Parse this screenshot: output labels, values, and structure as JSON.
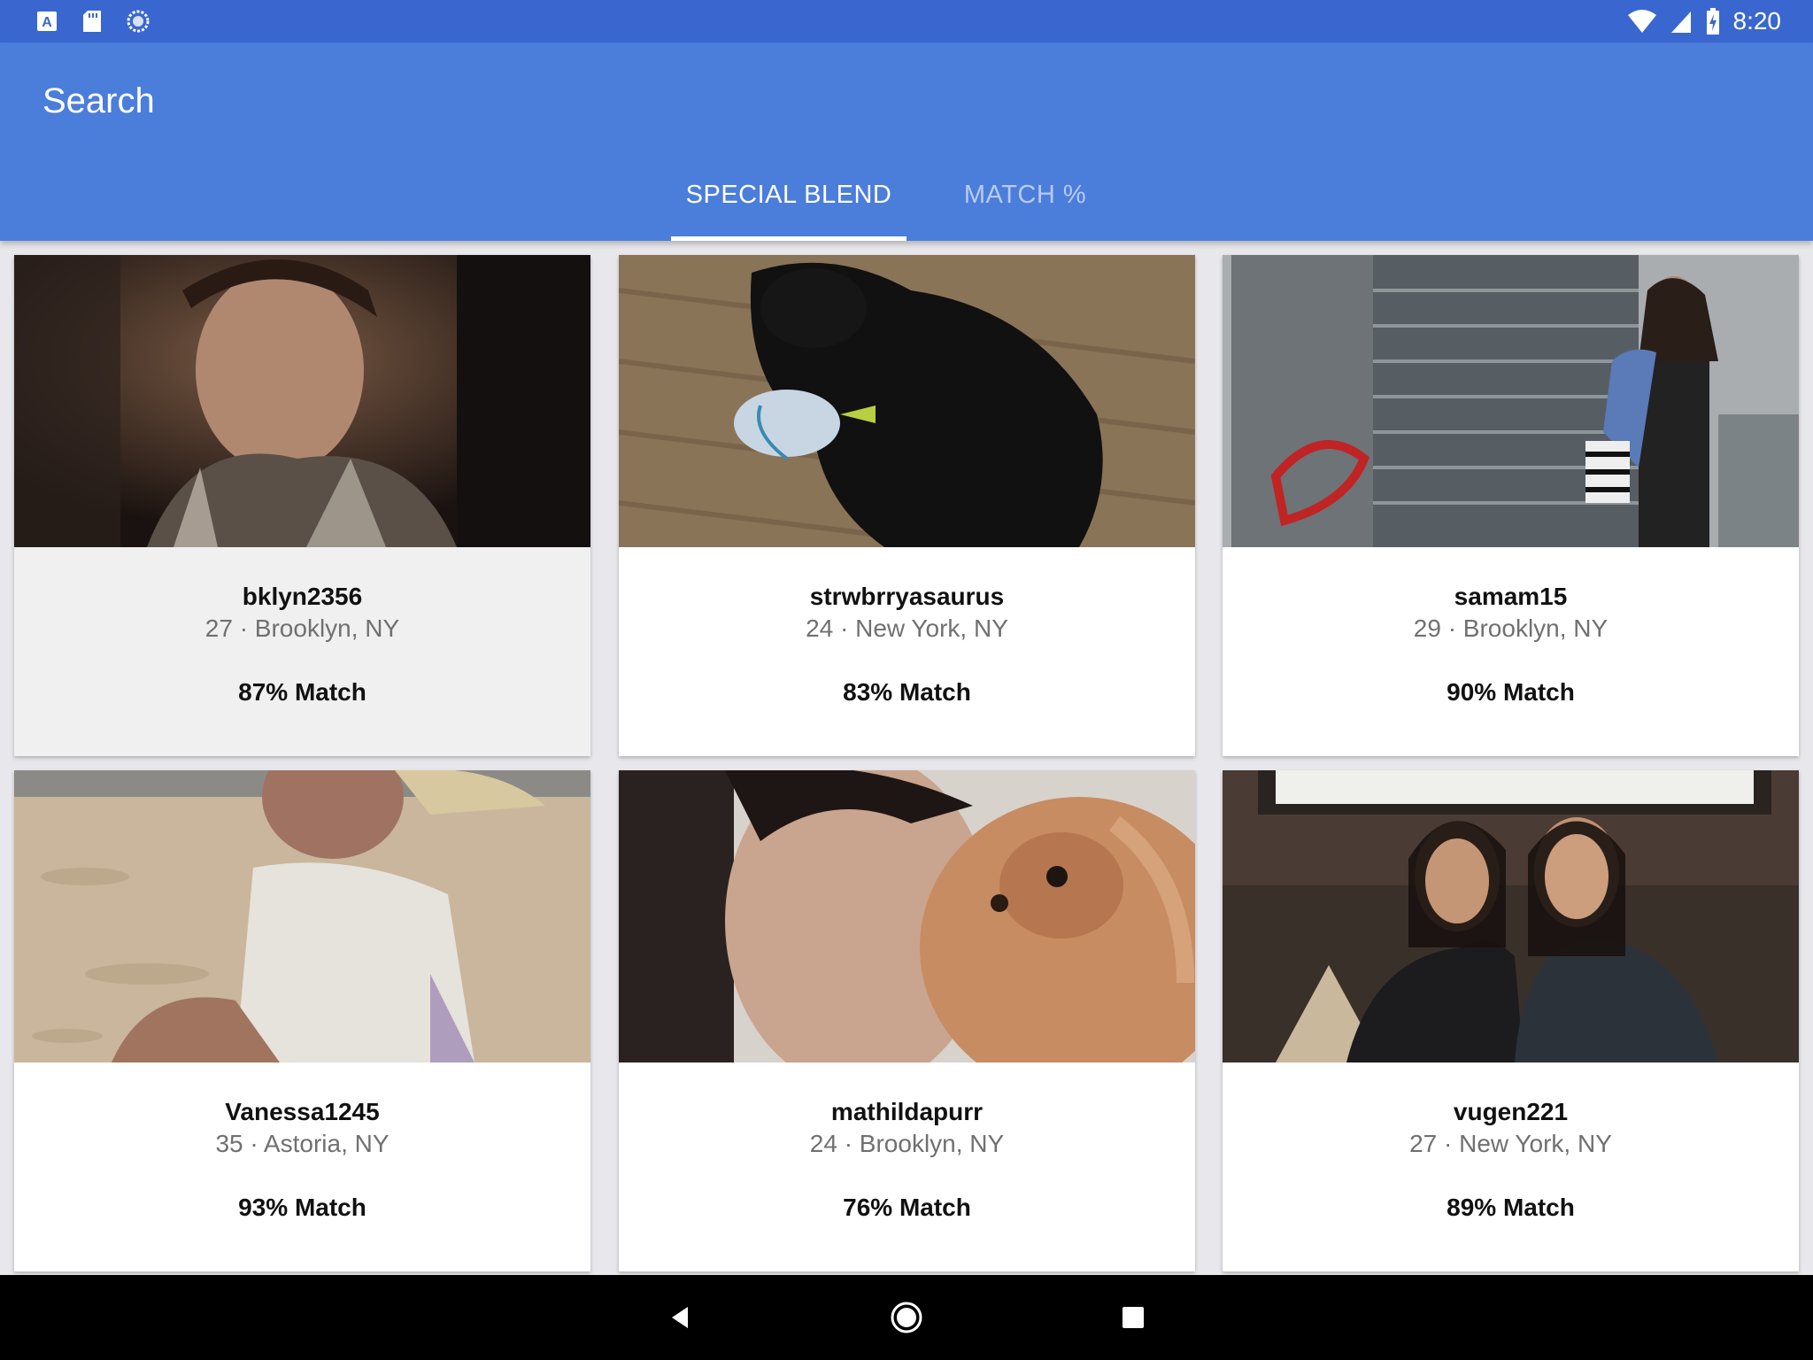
{
  "status_bar": {
    "time": "8:20",
    "left_icons": [
      "app-a-icon",
      "sd-card-icon",
      "sync-icon"
    ],
    "right_icons": [
      "wifi-icon",
      "cell-signal-icon",
      "battery-charging-icon"
    ]
  },
  "app_bar": {
    "title": "Search",
    "tabs": [
      {
        "label": "SPECIAL BLEND",
        "selected": true
      },
      {
        "label": "MATCH %",
        "selected": false
      }
    ]
  },
  "colors": {
    "status_bar": "#3a67cf",
    "app_bar": "#4b7ddb",
    "background": "#e8e8ec"
  },
  "profiles": [
    {
      "username": "bklyn2356",
      "meta": "27 · Brooklyn, NY",
      "match": "87% Match",
      "photo": "woman-at-night-party"
    },
    {
      "username": "strwbrryasaurus",
      "meta": "24 · New York, NY",
      "match": "83% Match",
      "photo": "black-kitten-with-toy"
    },
    {
      "username": "samam15",
      "meta": "29 · Brooklyn, NY",
      "match": "90% Match",
      "photo": "woman-by-pepsi-sign"
    },
    {
      "username": "Vanessa1245",
      "meta": "35 · Astoria, NY",
      "match": "93% Match",
      "photo": "woman-on-beach"
    },
    {
      "username": "mathildapurr",
      "meta": "24 · Brooklyn, NY",
      "match": "76% Match",
      "photo": "woman-with-dog"
    },
    {
      "username": "vugen221",
      "meta": "27 · New York, NY",
      "match": "89% Match",
      "photo": "two-women-smiling"
    }
  ],
  "nav_bar": {
    "buttons": [
      "back-icon",
      "home-icon",
      "recents-icon"
    ]
  }
}
